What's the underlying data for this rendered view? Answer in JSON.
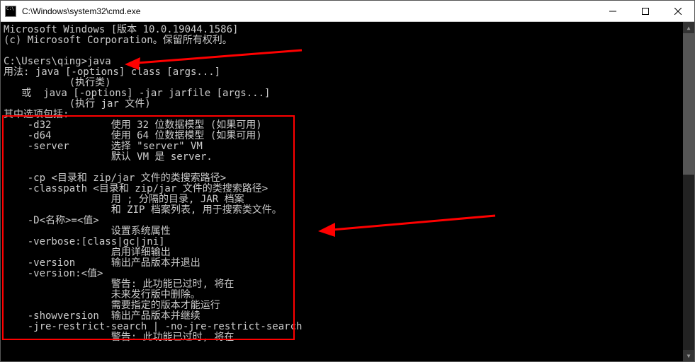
{
  "title": "C:\\Windows\\system32\\cmd.exe",
  "lines": [
    "Microsoft Windows [版本 10.0.19044.1586]",
    "(c) Microsoft Corporation。保留所有权利。",
    "",
    "C:\\Users\\qing>java",
    "用法: java [-options] class [args...]",
    "           (执行类)",
    "   或  java [-options] -jar jarfile [args...]",
    "           (执行 jar 文件)",
    "其中选项包括:",
    "    -d32          使用 32 位数据模型 (如果可用)",
    "    -d64          使用 64 位数据模型 (如果可用)",
    "    -server       选择 \"server\" VM",
    "                  默认 VM 是 server.",
    "",
    "    -cp <目录和 zip/jar 文件的类搜索路径>",
    "    -classpath <目录和 zip/jar 文件的类搜索路径>",
    "                  用 ; 分隔的目录, JAR 档案",
    "                  和 ZIP 档案列表, 用于搜索类文件。",
    "    -D<名称>=<值>",
    "                  设置系统属性",
    "    -verbose:[class|gc|jni]",
    "                  启用详细输出",
    "    -version      输出产品版本并退出",
    "    -version:<值>",
    "                  警告: 此功能已过时, 将在",
    "                  未来发行版中删除。",
    "                  需要指定的版本才能运行",
    "    -showversion  输出产品版本并继续",
    "    -jre-restrict-search | -no-jre-restrict-search",
    "                  警告: 此功能已过时, 将在"
  ]
}
